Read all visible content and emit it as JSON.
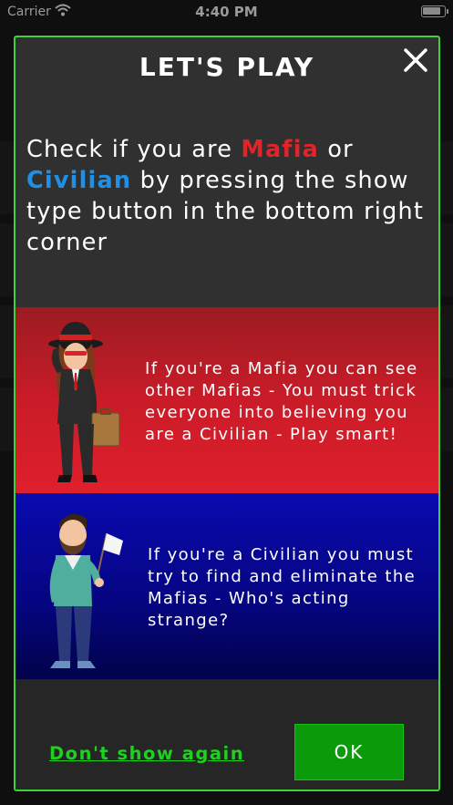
{
  "status_bar": {
    "carrier": "Carrier",
    "wifi_icon": "wifi-icon",
    "time": "4:40 PM",
    "battery_icon": "battery-icon"
  },
  "modal": {
    "title": "LET'S PLAY",
    "close_icon": "close-icon",
    "intro": {
      "part1": "Check if you are ",
      "mafia": "Mafia",
      "part2": " or ",
      "civilian": "Civilian",
      "part3": " by pressing the show type button in the bottom right corner"
    },
    "mafia_panel": {
      "text": "If you're a Mafia you can see other Mafias - You must trick everyone into believing you are a Civilian - Play smart!",
      "illustration": "mafia-character"
    },
    "civilian_panel": {
      "text": "If you're a Civilian you must try to find and eliminate the Mafias - Who's acting strange?",
      "illustration": "civilian-character"
    },
    "dont_show_label": "Don't show again",
    "ok_label": "OK"
  },
  "colors": {
    "modal_border": "#3bd23b",
    "mafia_red": "#e0242a",
    "civilian_blue": "#1f90e6",
    "ok_green": "#0a9a0a",
    "link_green": "#1fd11f"
  }
}
